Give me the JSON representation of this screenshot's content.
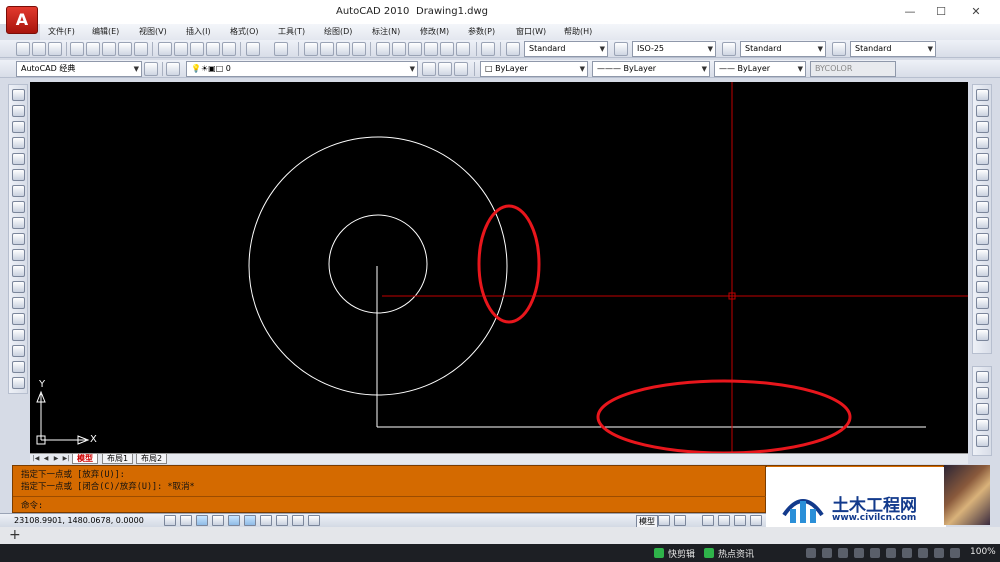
{
  "window": {
    "app_title": "AutoCAD 2010",
    "doc_title": "Drawing1.dwg",
    "logo_letter": "A",
    "minimize": "—",
    "maximize": "☐",
    "close": "✕"
  },
  "menu": [
    "文件(F)",
    "编辑(E)",
    "视图(V)",
    "插入(I)",
    "格式(O)",
    "工具(T)",
    "绘图(D)",
    "标注(N)",
    "修改(M)",
    "参数(P)",
    "窗口(W)",
    "帮助(H)"
  ],
  "toolbar_styles": {
    "text_style": "Standard",
    "dim_style": "ISO-25",
    "table_style": "Standard",
    "multileader_style": "Standard"
  },
  "toolbar_layers": {
    "workspace": "AutoCAD 经典",
    "layer": "0",
    "color": "ByLayer",
    "linetype": "ByLayer",
    "lineweight": "ByLayer",
    "plotstyle": "BYCOLOR"
  },
  "ucs": {
    "x_label": "X",
    "y_label": "Y"
  },
  "layout_tabs": [
    "模型",
    "布局1",
    "布局2"
  ],
  "command": {
    "line1": "指定下一点或 [放弃(U)]:",
    "line2": "指定下一点或 [闭合(C)/放弃(U)]: *取消*",
    "prompt": "命令:"
  },
  "status": {
    "coordinates": "23108.9901, 1480.0678, 0.0000",
    "model": "模型"
  },
  "watermark": {
    "name": "土木工程网",
    "url": "www.civilcn.com"
  },
  "taskbar": {
    "item1": "快剪辑",
    "item2": "热点资讯",
    "zoom": "100%"
  },
  "colors": {
    "canvas": "#000000",
    "command_bg": "#d46a00",
    "crosshair": "#c00000",
    "annotation": "#e8161c",
    "geometry": "#ffffff",
    "watermark_text": "#123a8c"
  }
}
